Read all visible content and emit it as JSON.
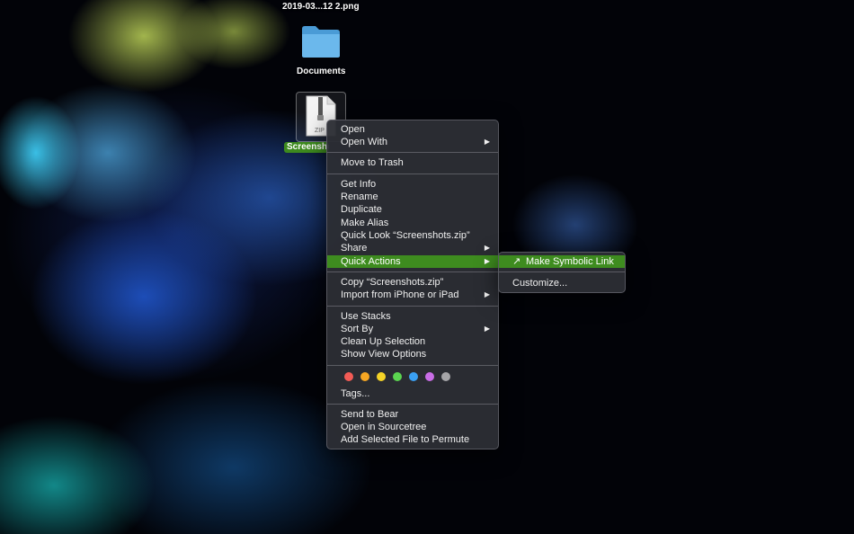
{
  "desktop": {
    "top_file_label": "2019-03...12 2.png",
    "folder_label": "Documents",
    "selected_file_label": "Screenshots.zip",
    "zip_icon_text": "ZIP"
  },
  "context_menu": {
    "group1": [
      "Open",
      "Open With"
    ],
    "group2": [
      "Move to Trash"
    ],
    "group3": [
      "Get Info",
      "Rename",
      "Duplicate",
      "Make Alias",
      "Quick Look “Screenshots.zip”",
      "Share",
      "Quick Actions"
    ],
    "group4": [
      "Copy “Screenshots.zip”",
      "Import from iPhone or iPad"
    ],
    "group5": [
      "Use Stacks",
      "Sort By",
      "Clean Up Selection",
      "Show View Options"
    ],
    "tags_label": "Tags...",
    "group7": [
      "Send to Bear",
      "Open in Sourcetree",
      "Add Selected File to Permute"
    ],
    "submenu_arrow": "▶",
    "tag_colors": [
      "#f25b55",
      "#f6a623",
      "#f5d327",
      "#5bd450",
      "#3aa0f3",
      "#c96de6",
      "#a5a5a8"
    ],
    "highlight_color": "#3e8c1f"
  },
  "quick_actions_submenu": {
    "items": [
      "Make Symbolic Link",
      "Customize..."
    ],
    "link_icon": "↗"
  }
}
